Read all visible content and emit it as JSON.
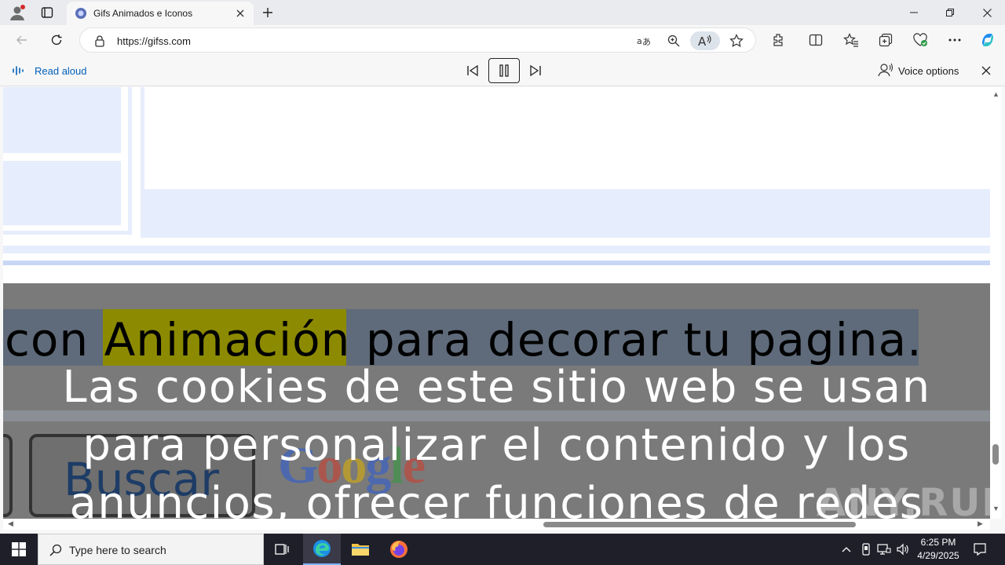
{
  "browser": {
    "tab_title": "Gifs Animados e Iconos",
    "url": "https://gifss.com"
  },
  "read_aloud": {
    "label": "Read aloud",
    "voice_options": "Voice options"
  },
  "page": {
    "highlight_line": {
      "before": "con ",
      "highlighted_word": "Animación",
      "after": " para decorar tu pagina."
    },
    "buscar_label": "Buscar",
    "google_logo": "Google",
    "cookie_lines": [
      "Las cookies de este sitio web se usan",
      "para personalizar el contenido y los",
      "anuncios, ofrecer funciones de redes"
    ],
    "watermark": "ANY.RUN"
  },
  "taskbar": {
    "search_placeholder": "Type here to search",
    "time": "6:25 PM",
    "date": "4/29/2025"
  },
  "colors": {
    "accent": "#005fb8",
    "highlight_word": "#8c8a00",
    "highlight_line": "#5f6b7a",
    "overlay": "#7a7a7a",
    "light_block": "#e6edfc"
  }
}
